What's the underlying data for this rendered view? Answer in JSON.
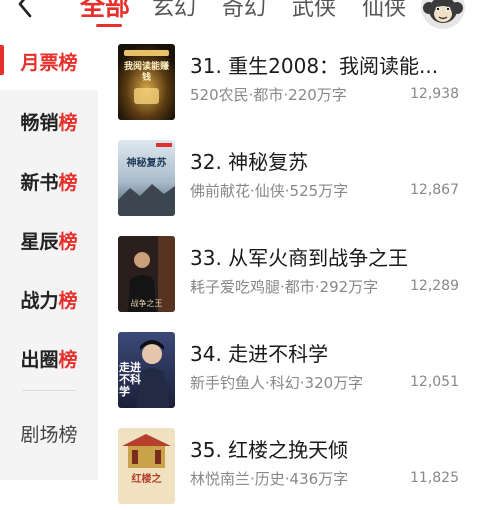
{
  "header": {
    "tabs": [
      {
        "label": "全部",
        "active": true
      },
      {
        "label": "玄幻"
      },
      {
        "label": "奇幻"
      },
      {
        "label": "武侠"
      },
      {
        "label": "仙侠"
      }
    ]
  },
  "sidebar": {
    "items": [
      {
        "head": "月票",
        "tail": "榜",
        "active": true
      },
      {
        "head": "畅销",
        "tail": "榜"
      },
      {
        "head": "新书",
        "tail": "榜"
      },
      {
        "head": "星辰",
        "tail": "榜"
      },
      {
        "head": "战力",
        "tail": "榜"
      },
      {
        "head": "出圈",
        "tail": "榜"
      },
      {
        "label": "剧场榜"
      }
    ]
  },
  "books": [
    {
      "title": "31. 重生2008：我阅读能...",
      "meta": "520农民·都市·220万字",
      "count": "12,938",
      "cover_text": "我阅读能赚钱"
    },
    {
      "title": "32. 神秘复苏",
      "meta": "佛前献花·仙侠·525万字",
      "count": "12,867",
      "cover_text": "神秘复苏"
    },
    {
      "title": "33. 从军火商到战争之王",
      "meta": "耗子爱吃鸡腿·都市·292万字",
      "count": "12,289",
      "cover_text": "战争之王"
    },
    {
      "title": "34. 走进不科学",
      "meta": "新手钓鱼人·科幻·320万字",
      "count": "12,051",
      "cover_text": "走进不科学"
    },
    {
      "title": "35. 红楼之挽天倾",
      "meta": "林悦南兰·历史·436万字",
      "count": "11,825",
      "cover_text": "红楼之"
    }
  ],
  "colors": {
    "accent": "#e8302b",
    "sidebar_bg": "#f4f4f4",
    "meta": "#888888"
  },
  "icons": {
    "back": "chevron-left-icon",
    "avatar": "monkey-avatar-icon"
  }
}
